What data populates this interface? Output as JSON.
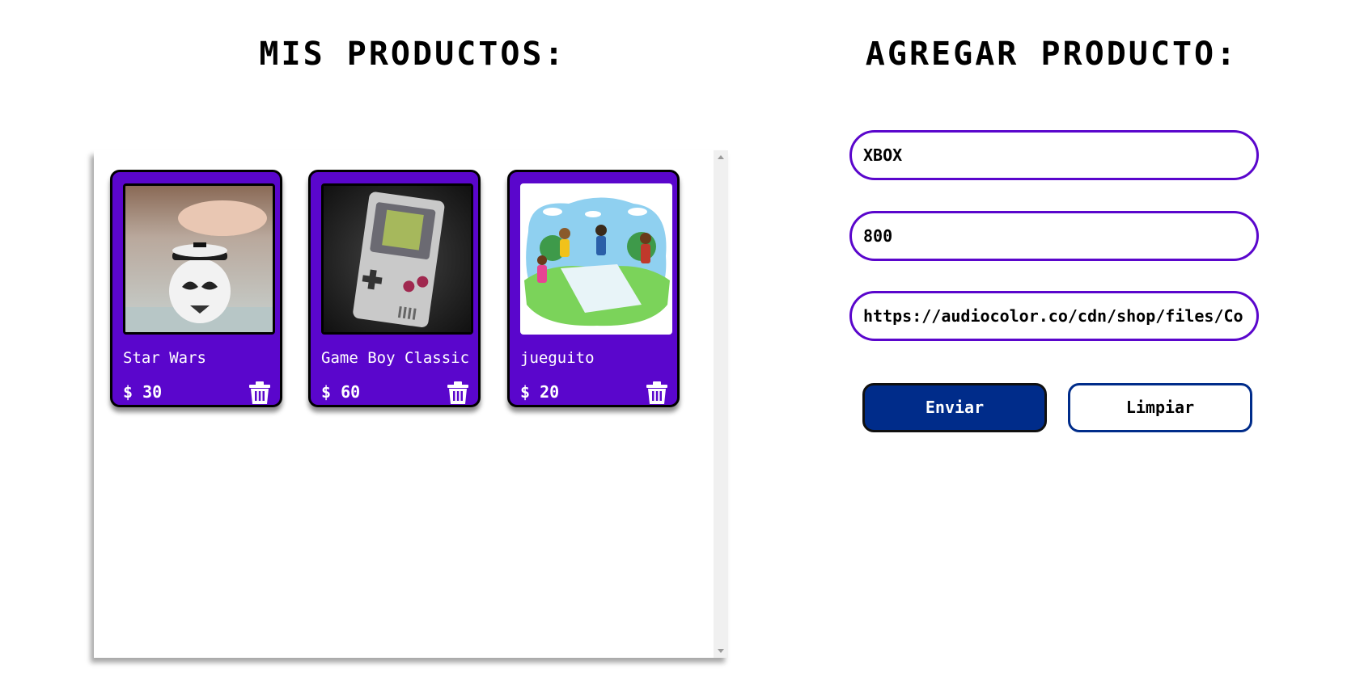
{
  "titles": {
    "products": "MIS PRODUCTOS:",
    "add": "AGREGAR PRODUCTO:"
  },
  "products": [
    {
      "name": "Star Wars",
      "price": "$ 30",
      "image_icon": "stormtrooper-piggy-bank-photo"
    },
    {
      "name": "Game Boy Classic",
      "price": "$ 60",
      "image_icon": "game-boy-photo"
    },
    {
      "name": "jueguito",
      "price": "$ 20",
      "image_icon": "kids-playing-hopscotch-illustration"
    }
  ],
  "form": {
    "name_value": "XBOX",
    "price_value": "800",
    "url_value": "https://audiocolor.co/cdn/shop/files/Co"
  },
  "buttons": {
    "send_label": "Enviar",
    "clear_label": "Limpiar"
  },
  "colors": {
    "card_purple": "#5a06cc",
    "send_blue": "#002c8a",
    "input_border": "#5a06cc"
  },
  "icons": {
    "delete": "trash-icon"
  }
}
